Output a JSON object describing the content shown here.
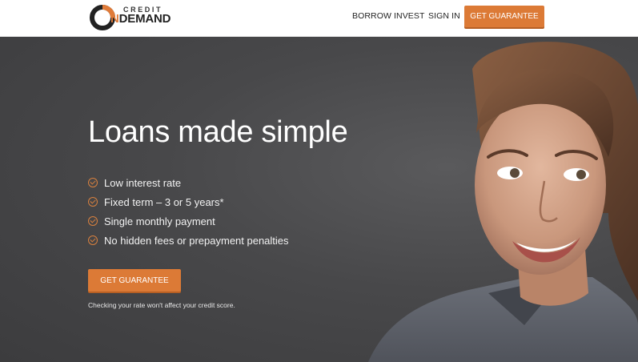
{
  "brand": {
    "logo_top": "CREDIT",
    "logo_mark": "O",
    "logo_on": "N",
    "logo_rest": "DEMAND",
    "accent_color": "#dc7a36"
  },
  "nav": {
    "items": [
      {
        "label": "BORROW"
      },
      {
        "label": "INVEST"
      },
      {
        "label": "SIGN IN"
      }
    ],
    "cta_label": "GET GUARANTEE"
  },
  "hero": {
    "title": "Loans made simple",
    "features": [
      {
        "text": "Low interest rate",
        "icon": "check-circle-icon"
      },
      {
        "text": "Fixed term – 3 or 5 years*",
        "icon": "check-circle-icon"
      },
      {
        "text": "Single monthly payment",
        "icon": "check-circle-icon"
      },
      {
        "text": "No hidden fees or prepayment penalties",
        "icon": "check-circle-icon"
      }
    ],
    "cta_label": "GET GUARANTEE",
    "disclaimer": "Checking your rate won't affect your credit score.",
    "image": "smiling-woman-portrait"
  }
}
